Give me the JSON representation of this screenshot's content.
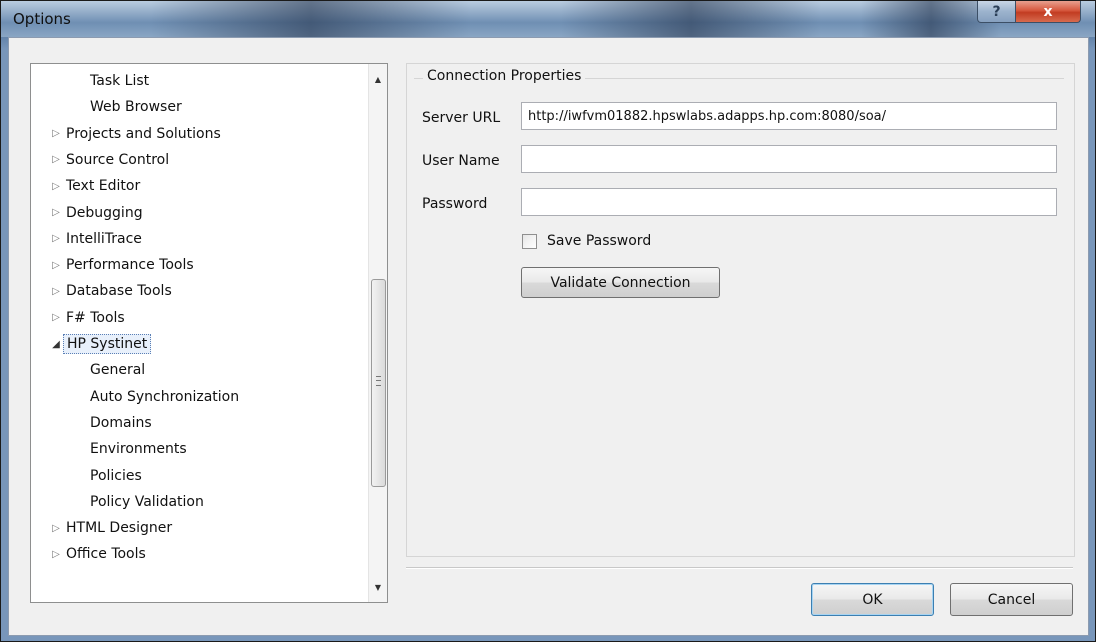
{
  "window": {
    "title": "Options",
    "help_label": "?",
    "close_label": "x"
  },
  "tree": {
    "items": [
      {
        "label": "Task List",
        "indent": 2,
        "arrow": ""
      },
      {
        "label": "Web Browser",
        "indent": 2,
        "arrow": ""
      },
      {
        "label": "Projects and Solutions",
        "indent": 1,
        "arrow": "▷"
      },
      {
        "label": "Source Control",
        "indent": 1,
        "arrow": "▷"
      },
      {
        "label": "Text Editor",
        "indent": 1,
        "arrow": "▷"
      },
      {
        "label": "Debugging",
        "indent": 1,
        "arrow": "▷"
      },
      {
        "label": "IntelliTrace",
        "indent": 1,
        "arrow": "▷"
      },
      {
        "label": "Performance Tools",
        "indent": 1,
        "arrow": "▷"
      },
      {
        "label": "Database Tools",
        "indent": 1,
        "arrow": "▷"
      },
      {
        "label": "F# Tools",
        "indent": 1,
        "arrow": "▷"
      },
      {
        "label": "HP Systinet",
        "indent": 1,
        "arrow": "◢"
      },
      {
        "label": "General",
        "indent": 2,
        "arrow": ""
      },
      {
        "label": "Auto Synchronization",
        "indent": 2,
        "arrow": ""
      },
      {
        "label": "Domains",
        "indent": 2,
        "arrow": ""
      },
      {
        "label": "Environments",
        "indent": 2,
        "arrow": ""
      },
      {
        "label": "Policies",
        "indent": 2,
        "arrow": ""
      },
      {
        "label": "Policy Validation",
        "indent": 2,
        "arrow": ""
      },
      {
        "label": "HTML Designer",
        "indent": 1,
        "arrow": "▷"
      },
      {
        "label": "Office Tools",
        "indent": 1,
        "arrow": "▷"
      }
    ],
    "selected_label": "HP Systinet"
  },
  "connection": {
    "group_title": "Connection Properties",
    "server_url_label": "Server URL",
    "server_url_value": "http://iwfvm01882.hpswlabs.adapps.hp.com:8080/soa/",
    "user_name_label": "User Name",
    "user_name_value": "",
    "password_label": "Password",
    "password_value": "",
    "save_password_label": "Save Password",
    "save_password_checked": false,
    "validate_label": "Validate Connection"
  },
  "footer": {
    "ok_label": "OK",
    "cancel_label": "Cancel"
  }
}
